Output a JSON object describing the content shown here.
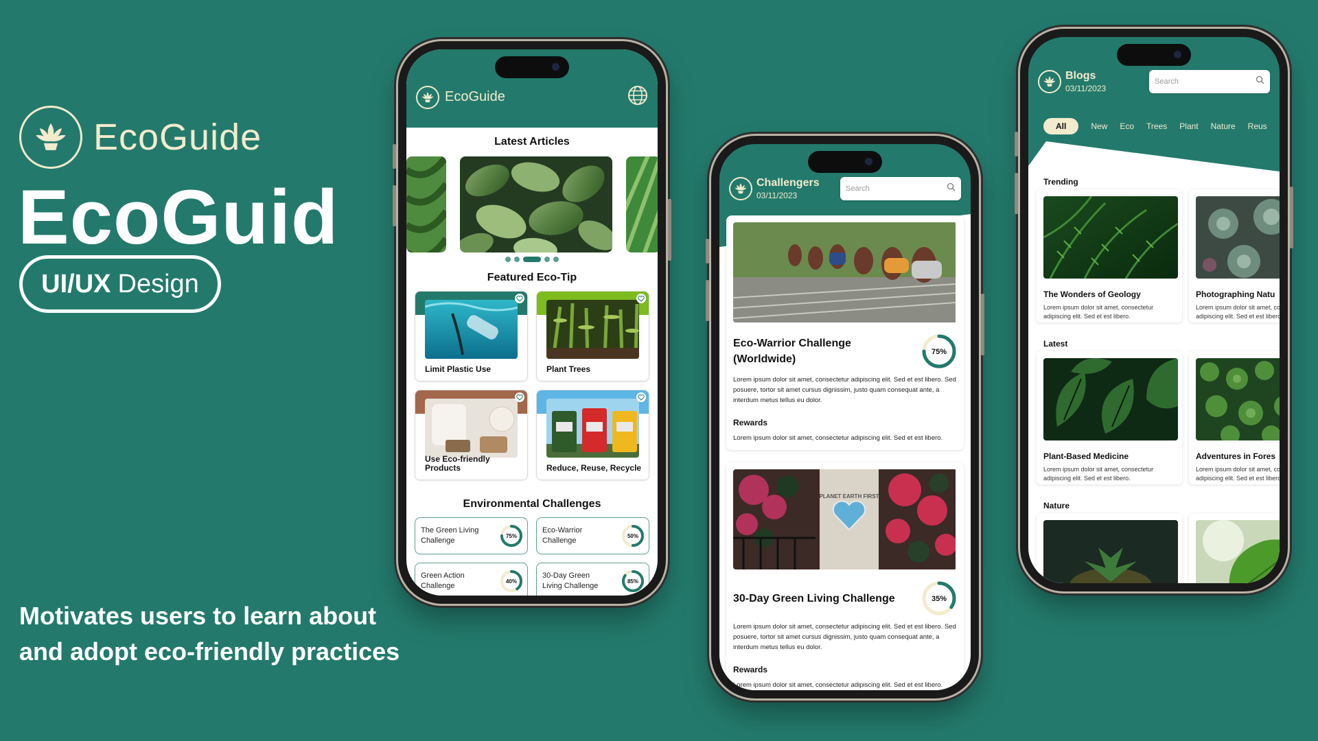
{
  "hero": {
    "brand_name": "EcoGuide",
    "title": "EcoGuid",
    "pill_bold": "UI/UX",
    "pill_rest": "Design",
    "tagline_line1": "Motivates users to learn about",
    "tagline_line2": "and adopt eco-friendly practices"
  },
  "colors": {
    "primary": "#237a6c",
    "cream": "#f3ebcd"
  },
  "icons": [
    "lotus-logo-icon",
    "globe-icon",
    "search-icon",
    "heart-icon"
  ],
  "phone1": {
    "app_name": "EcoGuide",
    "latest_articles": "Latest Articles",
    "featured_eco_tip": "Featured Eco-Tip",
    "tips": [
      "Limit Plastic Use",
      "Plant Trees",
      "Use Eco-friendly Products",
      "Reduce, Reuse, Recycle"
    ],
    "env_challenges": "Environmental Challenges",
    "challenges": [
      {
        "name": "The Green Living Challenge",
        "progress_label": "75%",
        "progress": 75
      },
      {
        "name": "Eco-Warrior Challenge",
        "progress_label": "50%",
        "progress": 50
      },
      {
        "name": "Green Action Challenge",
        "progress_label": "40%",
        "progress": 40
      },
      {
        "name": "30-Day Green Living Challenge",
        "progress_label": "85%",
        "progress": 85
      }
    ]
  },
  "phone2": {
    "title": "Challengers",
    "date": "03/11/2023",
    "search_placeholder": "Search",
    "cards": [
      {
        "name": "Eco-Warrior Challenge (Worldwide)",
        "progress_label": "75%",
        "progress": 75,
        "desc": "Lorem ipsum dolor sit amet, consectetur adipiscing elit. Sed et est libero. Sed posuere, tortor sit amet cursus dignissim, justo quam consequat ante, a interdum metus tellus eu dolor.",
        "rewards_label": "Rewards",
        "rewards": "Lorem ipsum dolor sit amet, consectetur adipiscing elit. Sed et est libero."
      },
      {
        "name": "30-Day Green Living Challenge",
        "progress_label": "35%",
        "progress": 35,
        "desc": "Lorem ipsum dolor sit amet, consectetur adipiscing elit. Sed et est libero. Sed posuere, tortor sit amet cursus dignissim, justo quam consequat ante, a interdum metus tellus eu dolor.",
        "rewards_label": "Rewards",
        "rewards": "Lorem ipsum dolor sit amet, consectetur adipiscing elit. Sed et est libero.",
        "sign_text": "PLANET EARTH FIRST"
      }
    ]
  },
  "phone3": {
    "title": "Blogs",
    "date": "03/11/2023",
    "search_placeholder": "Search",
    "filters": [
      "All",
      "New",
      "Eco",
      "Trees",
      "Plant",
      "Nature",
      "Reus"
    ],
    "sections": [
      {
        "title": "Trending",
        "cards": [
          {
            "title": "The Wonders of Geology",
            "desc": "Lorem ipsum dolor sit amet, consectetur adipiscing elit. Sed et est libero."
          },
          {
            "title": "Photographing Natu",
            "desc": "Lorem ipsum dolor sit amet, consectetur adipiscing elit. Sed et est libero."
          }
        ]
      },
      {
        "title": "Latest",
        "cards": [
          {
            "title": "Plant-Based Medicine",
            "desc": "Lorem ipsum dolor sit amet, consectetur adipiscing elit. Sed et est libero."
          },
          {
            "title": "Adventures in Fores",
            "desc": "Lorem ipsum dolor sit amet, consectetur adipiscing elit. Sed et est libero."
          }
        ]
      },
      {
        "title": "Nature",
        "cards": [
          {
            "title": "",
            "desc": ""
          },
          {
            "title": "",
            "desc": ""
          }
        ]
      }
    ]
  }
}
